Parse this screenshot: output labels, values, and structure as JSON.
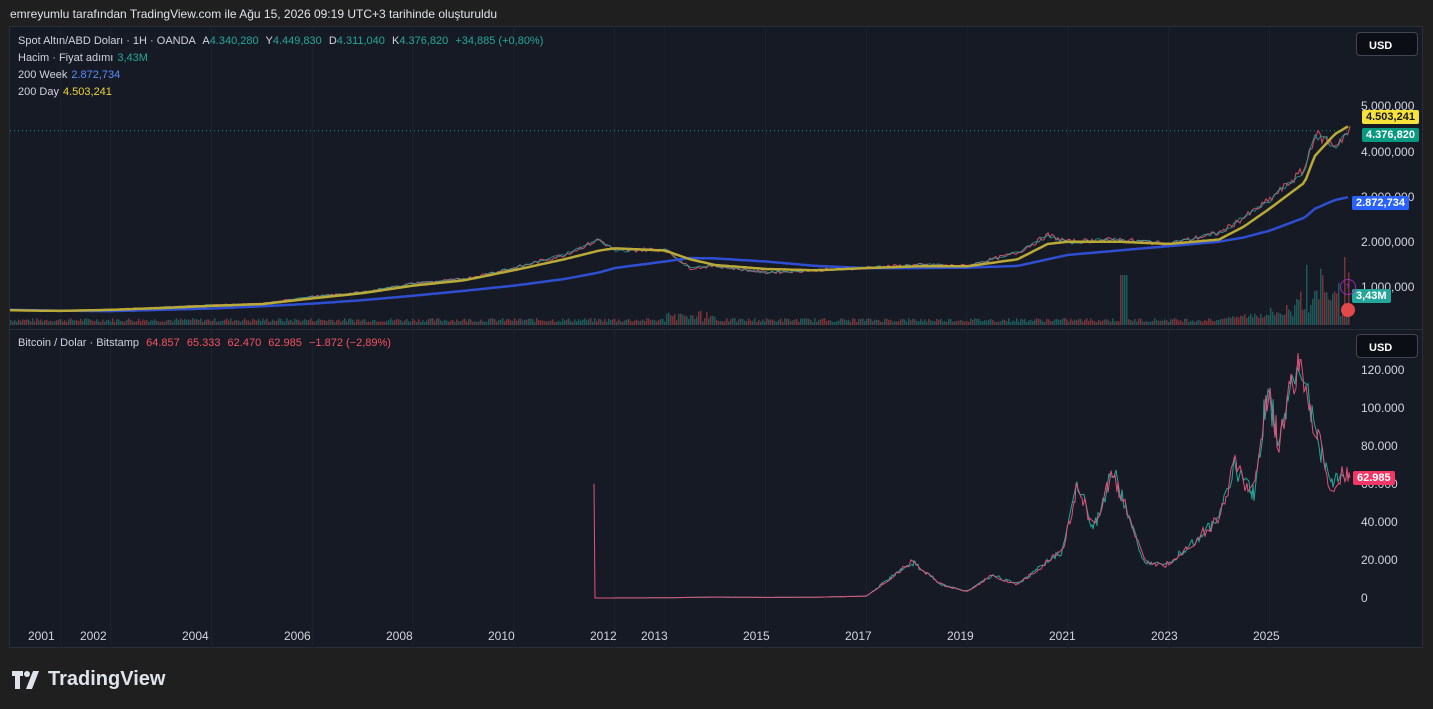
{
  "header": {
    "caption": "emreyumlu tarafından TradingView.com ile Ağu 15, 2026 09:19 UTC+3 tarihinde oluşturuldu"
  },
  "pane1": {
    "symbol": "Spot Altın/ABD Doları · 1H · OANDA",
    "o_label": "A",
    "o": "4.340,280",
    "h_label": "Y",
    "h": "4.449,830",
    "l_label": "D",
    "l": "4.311,040",
    "c_label": "K",
    "c": "4.376,820",
    "change": "+34,885 (+0,80%)",
    "volume_label": "Hacim · Fiyat adımı",
    "volume_value": "3,43M",
    "ma200w_label": "200 Week",
    "ma200w_value": "2.872,734",
    "ma200d_label": "200 Day",
    "ma200d_value": "4.503,241",
    "currency": "USD",
    "axis": [
      "5.000,000",
      "4.000,000",
      "3.000,000",
      "2.000,000",
      "1.000,000"
    ],
    "tags": {
      "ma200d": "4.503,241",
      "close": "4.376,820",
      "ma200w": "2.872,734",
      "volume": "3,43M"
    },
    "colors": {
      "up": "#26a69a",
      "down": "#ef5350",
      "ma200d": "#c8b937",
      "ma200w": "#2962ff",
      "price": "#089981"
    }
  },
  "pane2": {
    "symbol": "Bitcoin / Dolar · Bitstamp",
    "o": "64.857",
    "h": "65.333",
    "l": "62.470",
    "c": "62.985",
    "change": "−1.872 (−2,89%)",
    "currency": "USD",
    "axis": [
      "120.000",
      "100.000",
      "80.000",
      "60.000",
      "40.000",
      "20.000",
      "0"
    ],
    "tag": "62.985",
    "colors": {
      "change": "#f7525f"
    }
  },
  "xaxis": [
    "2001",
    "2002",
    "2004",
    "2006",
    "2008",
    "2010",
    "2012",
    "2013",
    "2015",
    "2017",
    "2019",
    "2021",
    "2023",
    "2025"
  ],
  "brand": "TradingView",
  "chart_data": [
    {
      "type": "line",
      "title": "Spot Altın/ABD Doları · 1H · OANDA",
      "x": [
        2000.0,
        2001,
        2002,
        2003,
        2004,
        2005,
        2006,
        2007,
        2008,
        2009,
        2010,
        2011,
        2011.7,
        2012,
        2013,
        2013.5,
        2014,
        2015,
        2016,
        2017,
        2018,
        2019,
        2020,
        2020.6,
        2021,
        2022,
        2023,
        2024,
        2024.5,
        2025,
        2025.7,
        2025.9,
        2026.3,
        2026.6
      ],
      "series": [
        {
          "name": "price",
          "values": [
            280,
            270,
            310,
            360,
            410,
            440,
            600,
            700,
            900,
            1000,
            1250,
            1550,
            1900,
            1650,
            1680,
            1250,
            1300,
            1150,
            1200,
            1260,
            1320,
            1300,
            1600,
            2000,
            1850,
            1900,
            1800,
            2050,
            2400,
            2800,
            3500,
            4300,
            4050,
            4376.82
          ]
        },
        {
          "name": "200 Day",
          "values": [
            290,
            275,
            300,
            340,
            390,
            430,
            560,
            680,
            850,
            970,
            1200,
            1450,
            1650,
            1700,
            1650,
            1450,
            1320,
            1230,
            1200,
            1250,
            1290,
            1290,
            1450,
            1800,
            1850,
            1850,
            1800,
            1900,
            2200,
            2600,
            3200,
            3800,
            4300,
            4503.241
          ]
        },
        {
          "name": "200 Week",
          "values": [
            300,
            280,
            270,
            300,
            330,
            380,
            440,
            520,
            620,
            730,
            850,
            1000,
            1150,
            1250,
            1400,
            1480,
            1470,
            1400,
            1300,
            1250,
            1250,
            1260,
            1300,
            1450,
            1550,
            1650,
            1750,
            1850,
            1950,
            2100,
            2400,
            2600,
            2800,
            2872.734
          ]
        }
      ],
      "ylim": [
        0,
        5600
      ]
    },
    {
      "type": "line",
      "title": "Bitcoin / Dolar · Bitstamp",
      "x": [
        2011.6,
        2013,
        2014,
        2015,
        2016,
        2017,
        2017.9,
        2018.5,
        2019,
        2019.5,
        2020,
        2020.9,
        2021.2,
        2021.5,
        2021.9,
        2022.5,
        2022.9,
        2023.5,
        2024.0,
        2024.3,
        2024.7,
        2024.9,
        2025.0,
        2025.2,
        2025.4,
        2025.6,
        2025.9,
        2026.0,
        2026.2,
        2026.5,
        2026.6
      ],
      "series": [
        {
          "name": "BTC",
          "values": [
            0,
            100,
            500,
            300,
            400,
            1000,
            19000,
            7000,
            3500,
            12000,
            7000,
            25000,
            60000,
            35000,
            67000,
            20000,
            16500,
            30000,
            42000,
            70000,
            55000,
            98000,
            105000,
            80000,
            110000,
            125000,
            90000,
            80000,
            60000,
            65000,
            62985
          ]
        }
      ],
      "ylim": [
        -10000,
        132000
      ]
    }
  ]
}
